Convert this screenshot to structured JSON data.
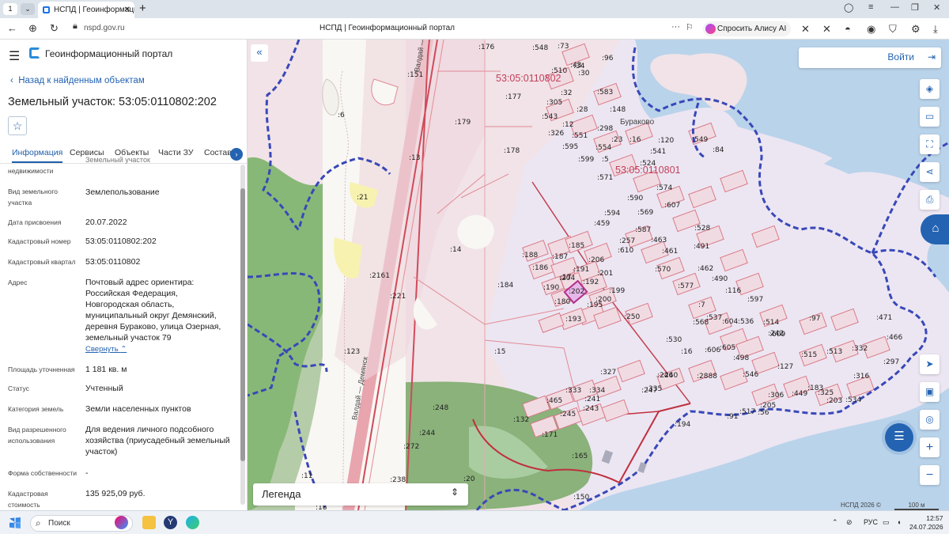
{
  "browser": {
    "tab_number": "1",
    "tab_title": "НСПД | Геоинформаци",
    "url": "nspd.gov.ru",
    "page_title": "НСПД | Геоинформационный портал",
    "alice_label": "Спросить Алису AI"
  },
  "panel": {
    "app_title": "Геоинформационный портал",
    "back_label": "Назад к найденным объектам",
    "title": "Земельный участок: 53:05:0110802:202",
    "tabs": [
      "Информация",
      "Сервисы",
      "Объекты",
      "Части ЗУ",
      "Состав"
    ],
    "partial_label": "недвижимости",
    "partial_value": "Земельный участок",
    "fields": [
      {
        "label": "Вид земельного участка",
        "value": "Землепользование"
      },
      {
        "label": "Дата присвоения",
        "value": "20.07.2022"
      },
      {
        "label": "Кадастровый номер",
        "value": "53:05:0110802:202"
      },
      {
        "label": "Кадастровый квартал",
        "value": "53:05:0110802"
      },
      {
        "label": "Адрес",
        "value": "Почтовый адрес ориентира: Российская Федерация, Новгородская область, муниципальный округ Демянский, деревня Бураково, улица Озерная, земельный участок 79"
      },
      {
        "label": "Площадь уточненная",
        "value": "1 181 кв. м"
      },
      {
        "label": "Статус",
        "value": "Учтенный"
      },
      {
        "label": "Категория земель",
        "value": "Земли населенных пунктов"
      },
      {
        "label": "Вид разрешенного использования",
        "value": "Для ведения личного подсобного хозяйства (приусадебный земельный участок)"
      },
      {
        "label": "Форма собственности",
        "value": "-"
      },
      {
        "label": "Кадастровая стоимость",
        "value": "135 925,09 руб."
      }
    ],
    "collapse_label": "Свернуть"
  },
  "map": {
    "login_label": "Войти",
    "legend_label": "Легенда",
    "copyright": "НСПД 2026 ©",
    "scale_label": "100 м",
    "quarter_labels": [
      "53:05:0110802",
      "53:05:0110801"
    ],
    "village_label": "Бураково",
    "road_labels": [
      "Валдай — Демянск",
      "Валдай — Демянск"
    ],
    "parcel_labels": [
      ":176",
      ":548",
      ":73",
      ":43",
      ":96",
      ":34",
      ":510",
      ":30",
      ":151",
      ":32",
      ":583",
      ":305",
      ":177",
      ":148",
      ":28",
      ":543",
      ":179",
      ":12",
      ":298",
      ":326",
      ":551",
      ":23",
      ":16",
      ":120",
      ":549",
      ":84",
      ":595",
      ":554",
      ":541",
      ":178",
      ":599",
      ":5",
      ":524",
      ":13",
      ":571",
      ":574",
      ":607",
      ":590",
      ":569",
      ":21",
      ":594",
      ":459",
      ":587",
      ":528",
      ":257",
      ":610",
      ":463",
      ":491",
      ":14",
      ":185",
      ":188",
      ":187",
      ":206",
      ":461",
      ":186",
      ":191",
      ":201",
      ":570",
      ":462",
      ":490",
      ":17",
      ":2161",
      ":204",
      ":192",
      ":577",
      ":116",
      ":184",
      ":190",
      ":202",
      ":199",
      ":180",
      ":200",
      ":195",
      ":7",
      ":597",
      ":221",
      ":193",
      ":250",
      ":537",
      ":536",
      ":97",
      ":471",
      ":530",
      ":568",
      ":514",
      ":242",
      ":604",
      ":466",
      ":123",
      ":15",
      ":16",
      ":606",
      ":605",
      ":609",
      ":515",
      ":513",
      ":332",
      ":498",
      ":127",
      ":297",
      ":327",
      ":246",
      ":240",
      ":2888",
      ":546",
      ":316",
      ":334",
      ":247",
      ":183",
      ":325",
      ":333",
      ":335",
      ":449",
      ":534",
      ":465",
      ":241",
      ":205",
      ":306",
      ":517",
      ":243",
      ":91",
      ":56",
      ":203",
      ":248",
      ":245",
      ":132",
      ":194",
      ":244",
      ":171",
      ":272",
      ":165",
      ":238",
      ":20",
      ":11",
      ":150",
      ":18",
      ":6"
    ]
  },
  "taskbar": {
    "search_label": "Поиск",
    "lang": "РУС",
    "time": "12:57",
    "date": "24.07.2026"
  }
}
